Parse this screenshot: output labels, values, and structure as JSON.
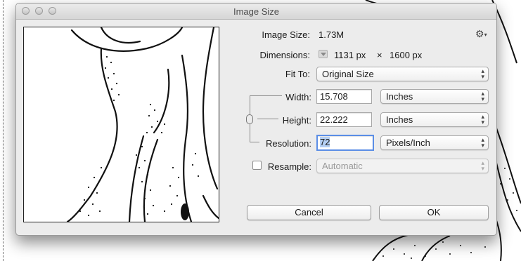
{
  "window": {
    "title": "Image Size"
  },
  "info": {
    "image_size_label": "Image Size:",
    "image_size_value": "1.73M",
    "dimensions_label": "Dimensions:",
    "dim_width": "1131 px",
    "dim_times": "×",
    "dim_height": "1600 px"
  },
  "fit_to": {
    "label": "Fit To:",
    "value": "Original Size"
  },
  "width": {
    "label": "Width:",
    "value": "15.708",
    "unit": "Inches"
  },
  "height": {
    "label": "Height:",
    "value": "22.222",
    "unit": "Inches"
  },
  "resolution": {
    "label": "Resolution:",
    "value": "72",
    "unit": "Pixels/Inch"
  },
  "resample": {
    "label": "Resample:",
    "value": "Automatic",
    "checked": false
  },
  "buttons": {
    "cancel": "Cancel",
    "ok": "OK"
  },
  "icons": {
    "settings": "gear-icon",
    "link": "chain-link-icon",
    "disclosure": "disclosure-triangle-icon"
  }
}
